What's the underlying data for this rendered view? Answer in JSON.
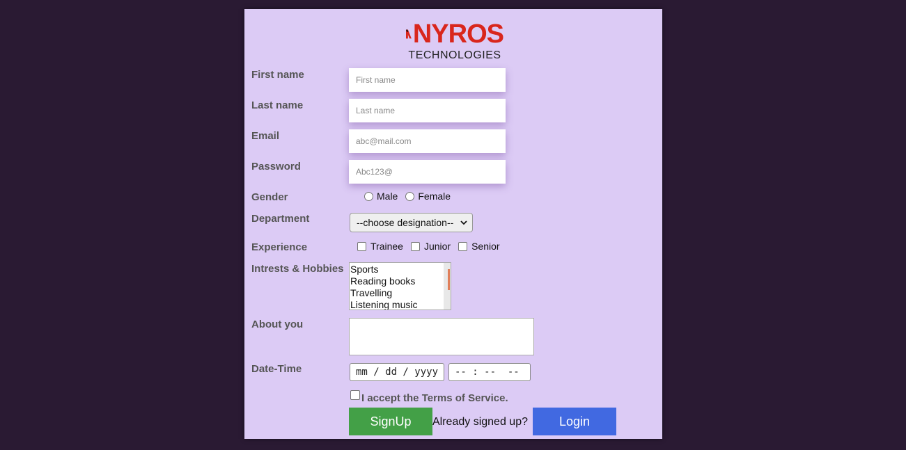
{
  "logo": {
    "name": "NYROS",
    "subtitle": "TECHNOLOGIES",
    "colors": {
      "brand_red": "#d9261c",
      "mark_dark": "#1a1a1a"
    }
  },
  "form": {
    "first_name": {
      "label": "First name",
      "placeholder": "First name"
    },
    "last_name": {
      "label": "Last name",
      "placeholder": "Last name"
    },
    "email": {
      "label": "Email",
      "placeholder": "abc@mail.com"
    },
    "password": {
      "label": "Password",
      "placeholder": "Abc123@"
    },
    "gender": {
      "label": "Gender",
      "options": [
        "Male",
        "Female"
      ]
    },
    "department": {
      "label": "Department",
      "selected": "--choose designation--"
    },
    "experience": {
      "label": "Experience",
      "options": [
        "Trainee",
        "Junior",
        "Senior"
      ]
    },
    "interests": {
      "label": "Intrests & Hobbies",
      "options": [
        "Sports",
        "Reading books",
        "Travelling",
        "Listening music"
      ]
    },
    "about": {
      "label": "About you"
    },
    "datetime": {
      "label": "Date-Time",
      "date_placeholder": "mm / dd / yyyy",
      "time_placeholder": "-- : --  --"
    },
    "terms": {
      "label": "I accept the Terms of Service."
    }
  },
  "actions": {
    "signup_label": "SignUp",
    "already_text": "Already signed up?",
    "login_label": "Login"
  },
  "colors": {
    "page_bg": "#2a1a33",
    "card_bg": "#dccbf5",
    "signup_bg": "#43a047",
    "login_bg": "#4169e1"
  }
}
